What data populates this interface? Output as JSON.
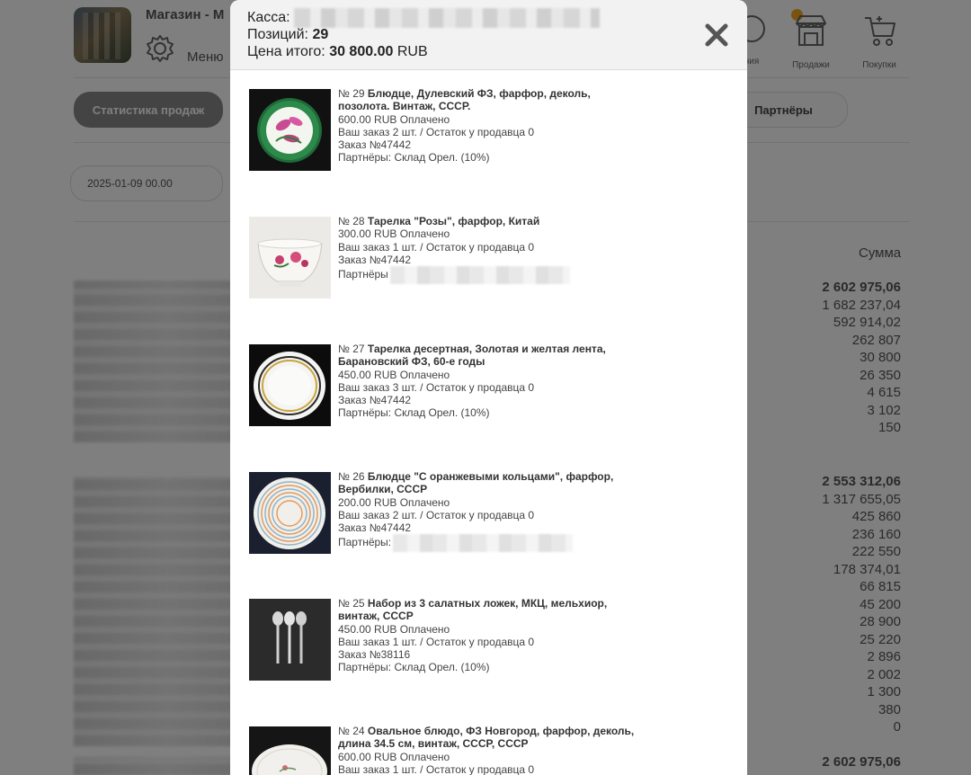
{
  "background": {
    "shop_title": "Магазин - М",
    "menu_label": "Меню",
    "nav": {
      "partial_label": "ния",
      "sales_label": "Продажи",
      "purchases_label": "Покупки"
    },
    "stats_button": "Статистика продаж",
    "partners_button": "Партнёры",
    "date_from": "2025-01-09 00.00",
    "sum_header": "Сумма",
    "sums_group1": [
      "2 602 975,06",
      "1 682 237,04",
      "592 914,02",
      "262 807",
      "30 800",
      "26 350",
      "4 615",
      "3 102",
      "150"
    ],
    "sums_group2": [
      "2 553 312,06",
      "1 317 655,05",
      "425 860",
      "236 160",
      "222 550",
      "178 374,01",
      "66 815",
      "45 200",
      "28 900",
      "25 220",
      "2 896",
      "2 002",
      "1 300",
      "380",
      "0"
    ],
    "sums_group3": [
      "2 602 975,06"
    ]
  },
  "modal": {
    "kassa_label": "Касса:",
    "positions_label": "Позиций:",
    "positions_value": "29",
    "total_label": "Цена итого:",
    "total_value": "30 800.00",
    "total_currency": "RUB",
    "items": [
      {
        "num": "№ 29",
        "title": "Блюдце, Дулевский ФЗ, фарфор, деколь, позолота. Винтаж, СССР.",
        "price": "600.00 RUB Оплачено",
        "order_qty": "Ваш заказ 2 шт. / Остаток у продавца 0",
        "order_no": "Заказ №47442",
        "partners": "Партнёры: Склад Орел. (10%)"
      },
      {
        "num": "№ 28",
        "title": "Тарелка \"Розы\", фарфор, Китай",
        "price": "300.00 RUB Оплачено",
        "order_qty": "Ваш заказ 1 шт. / Остаток у продавца 0",
        "order_no": "Заказ №47442",
        "partners": "Партнёры"
      },
      {
        "num": "№ 27",
        "title": "Тарелка десертная, Золотая и желтая лента, Барановский ФЗ, 60-е годы",
        "price": "450.00 RUB Оплачено",
        "order_qty": "Ваш заказ 3 шт. / Остаток у продавца 0",
        "order_no": "Заказ №47442",
        "partners": "Партнёры: Склад Орел. (10%)"
      },
      {
        "num": "№ 26",
        "title": "Блюдце \"С оранжевыми кольцами\", фарфор, Вербилки, СССР",
        "price": "200.00 RUB Оплачено",
        "order_qty": "Ваш заказ 2 шт. / Остаток у продавца 0",
        "order_no": "Заказ №47442",
        "partners": "Партнёры:"
      },
      {
        "num": "№ 25",
        "title": "Набор из 3 салатных ложек, МКЦ, мельхиор, винтаж, СССР",
        "price": "450.00 RUB Оплачено",
        "order_qty": "Ваш заказ 1 шт. / Остаток у продавца 0",
        "order_no": "Заказ №38116",
        "partners": "Партнёры: Склад Орел. (10%)"
      },
      {
        "num": "№ 24",
        "title": "Овальное блюдо, ФЗ Новгород, фарфор, деколь, длина 34.5 см, винтаж, СССР, СССР",
        "price": "600.00 RUB Оплачено",
        "order_qty": "Ваш заказ 1 шт. / Остаток у продавца 0",
        "order_no": "",
        "partners": ""
      }
    ]
  }
}
